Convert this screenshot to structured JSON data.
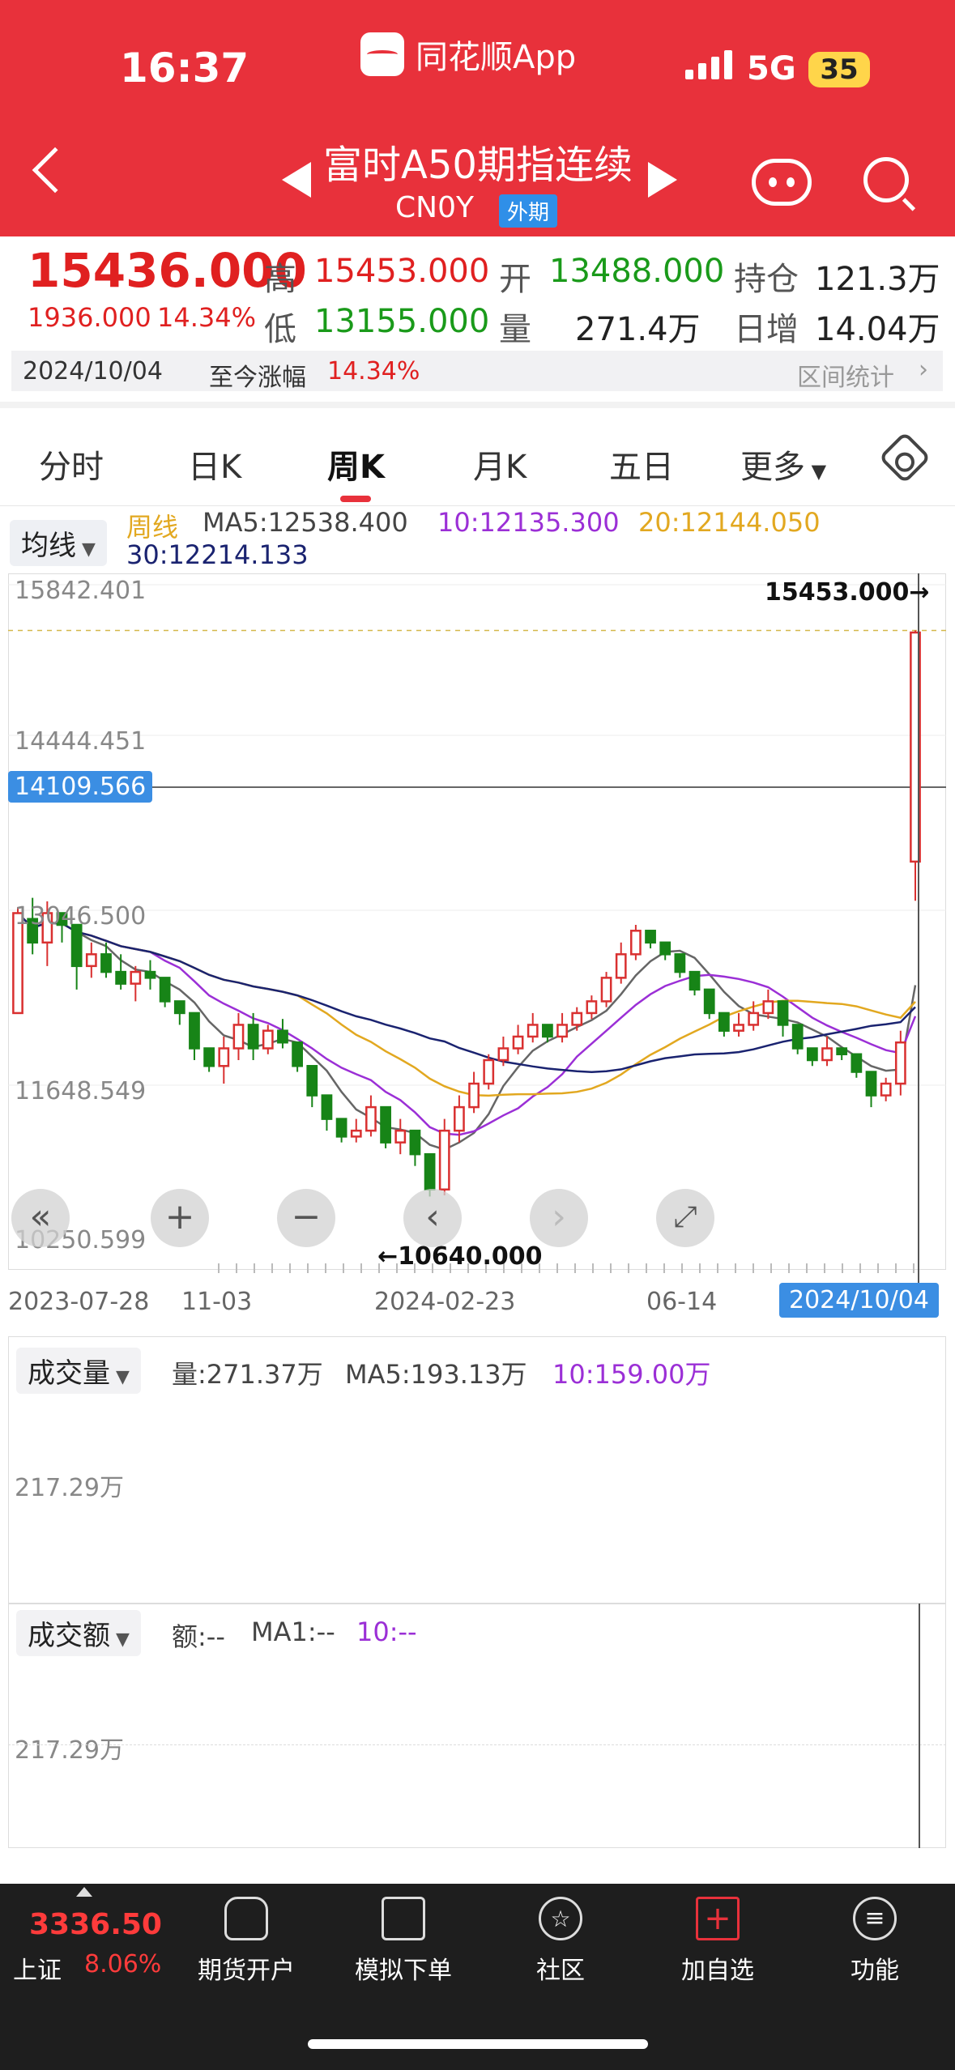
{
  "status": {
    "time": "16:37",
    "app": "同花顺App",
    "network": "5G",
    "battery": "35"
  },
  "nav": {
    "title": "富时A50期指连续",
    "code": "CN0Y",
    "tag": "外期"
  },
  "quote": {
    "price": "15436.000",
    "change": "1936.000",
    "change_pct": "14.34%",
    "high_label": "高",
    "high": "15453.000",
    "open_label": "开",
    "open": "13488.000",
    "pos_label": "持仓",
    "pos": "121.3万",
    "low_label": "低",
    "low": "13155.000",
    "vol_label": "量",
    "vol": "271.4万",
    "inc_label": "日增",
    "inc": "14.04万",
    "date": "2024/10/04",
    "since_label": "至今涨幅",
    "since_pct": "14.34%",
    "stat_link": "区间统计"
  },
  "tabs": [
    "分时",
    "日K",
    "周K",
    "月K",
    "五日",
    "更多"
  ],
  "active_tab": "周K",
  "ma": {
    "pill": "均线",
    "period": "周线",
    "ma5": "MA5:12538.400",
    "ma10": "10:12135.300",
    "ma20": "20:12144.050",
    "ma30": "30:12214.133"
  },
  "price_axis": {
    "top": "15842.401",
    "l2": "14444.451",
    "cursor": "14109.566",
    "l3": "13046.500",
    "l4": "11648.549",
    "bottom": "10250.599",
    "max_mark": "15453.000→",
    "min_mark": "←10640.000"
  },
  "dates": {
    "d1": "2023-07-28",
    "d2": "11-03",
    "d3": "2024-02-23",
    "d4": "06-14",
    "d5": "2024/10/04"
  },
  "volume": {
    "pill": "成交量",
    "vol": "量:271.37万",
    "ma5": "MA5:193.13万",
    "ma10": "10:159.00万",
    "axis": "217.29万"
  },
  "amount": {
    "pill": "成交额",
    "amt": "额:--",
    "ma1": "MA1:--",
    "ma10": "10:--",
    "axis": "217.29万"
  },
  "bottom": {
    "index_value": "3336.50",
    "index_name": "上证",
    "index_pct": "8.06%",
    "items": [
      "期货开户",
      "模拟下单",
      "社区",
      "加自选",
      "功能"
    ]
  },
  "colors": {
    "header": "#e8313b",
    "up": "#d93030",
    "down": "#178417",
    "ma5": "#666666",
    "ma10": "#9b2fd6",
    "ma20": "#e2a820",
    "ma30": "#1a2370"
  },
  "chart_data": {
    "type": "candlestick",
    "period": "weekly",
    "ylim": [
      10250.599,
      15842.401
    ],
    "x_ticks": [
      "2023-07-28",
      "11-03",
      "2024-02-23",
      "06-14",
      "2024/10/04"
    ],
    "candles": [
      [
        12200,
        13050,
        12300,
        13100
      ],
      [
        13000,
        12800,
        13180,
        12700
      ],
      [
        12800,
        13050,
        12600,
        13150
      ],
      [
        13050,
        12950,
        12980,
        12800
      ],
      [
        12950,
        12600,
        12900,
        12400
      ],
      [
        12600,
        12700,
        12500,
        12800
      ],
      [
        12700,
        12550,
        12500,
        12800
      ],
      [
        12550,
        12450,
        12400,
        12700
      ],
      [
        12450,
        12550,
        12300,
        12600
      ],
      [
        12550,
        12500,
        12400,
        12650
      ],
      [
        12500,
        12300,
        12350,
        12250
      ],
      [
        12300,
        12200,
        12250,
        12100
      ],
      [
        12200,
        11900,
        12000,
        11800
      ],
      [
        11900,
        11750,
        11700,
        11900
      ],
      [
        11750,
        11900,
        11600,
        12000
      ],
      [
        11900,
        12100,
        11800,
        12200
      ],
      [
        12100,
        11900,
        12200,
        11800
      ],
      [
        11900,
        12050,
        11850,
        12100
      ],
      [
        12050,
        11950,
        11900,
        12150
      ],
      [
        11950,
        11750,
        11800,
        11700
      ],
      [
        11750,
        11500,
        11550,
        11400
      ],
      [
        11500,
        11300,
        11350,
        11200
      ],
      [
        11300,
        11150,
        11200,
        11100
      ],
      [
        11150,
        11200,
        11100,
        11300
      ],
      [
        11200,
        11400,
        11150,
        11500
      ],
      [
        11400,
        11100,
        11150,
        11050
      ],
      [
        11100,
        11200,
        11000,
        11300
      ],
      [
        11200,
        11000,
        11000,
        10900
      ],
      [
        11000,
        10700,
        10750,
        10640
      ],
      [
        10700,
        11200,
        10650,
        11300
      ],
      [
        11200,
        11400,
        11100,
        11500
      ],
      [
        11400,
        11600,
        11350,
        11700
      ],
      [
        11600,
        11800,
        11550,
        11850
      ],
      [
        11800,
        11900,
        11750,
        12000
      ],
      [
        11900,
        12000,
        11850,
        12100
      ],
      [
        12000,
        12100,
        11950,
        12200
      ],
      [
        12100,
        12000,
        12050,
        11950
      ],
      [
        12000,
        12100,
        11950,
        12200
      ],
      [
        12100,
        12200,
        12050,
        12250
      ],
      [
        12200,
        12300,
        12150,
        12350
      ],
      [
        12300,
        12500,
        12250,
        12550
      ],
      [
        12500,
        12700,
        12450,
        12800
      ],
      [
        12700,
        12900,
        12650,
        12950
      ],
      [
        12900,
        12800,
        12850,
        12750
      ],
      [
        12800,
        12700,
        12750,
        12650
      ],
      [
        12700,
        12550,
        12600,
        12500
      ],
      [
        12550,
        12400,
        12450,
        12350
      ],
      [
        12400,
        12200,
        12250,
        12150
      ],
      [
        12200,
        12050,
        12100,
        12000
      ],
      [
        12050,
        12100,
        12000,
        12200
      ],
      [
        12100,
        12200,
        12050,
        12300
      ],
      [
        12200,
        12300,
        12150,
        12400
      ],
      [
        12300,
        12100,
        12200,
        12000
      ],
      [
        12100,
        11900,
        11950,
        11850
      ],
      [
        11900,
        11800,
        11850,
        11750
      ],
      [
        11800,
        11900,
        11750,
        12000
      ],
      [
        11900,
        11850,
        11850,
        11800
      ],
      [
        11850,
        11700,
        11750,
        11650
      ],
      [
        11700,
        11500,
        11550,
        11400
      ],
      [
        11500,
        11600,
        11450,
        11650
      ],
      [
        11600,
        11950,
        11500,
        12050
      ],
      [
        13488,
        15436,
        13155,
        15453
      ]
    ],
    "volume_axis": "217.29万",
    "last_volume": "271.37万"
  }
}
